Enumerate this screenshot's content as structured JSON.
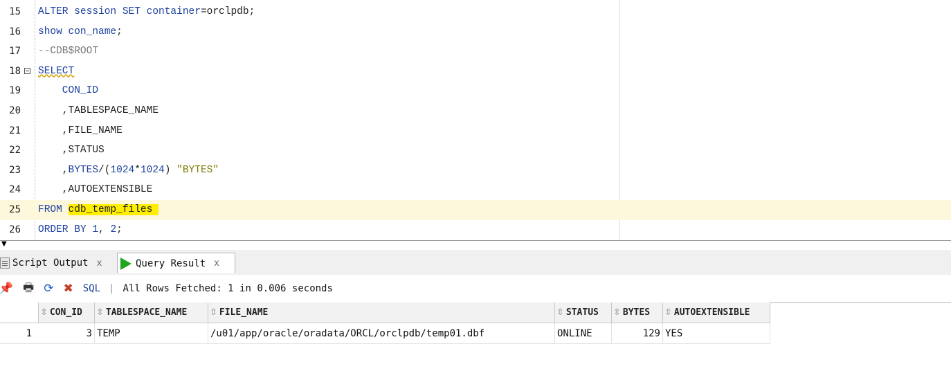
{
  "editor": {
    "lines": [
      {
        "num": "15",
        "text": "ALTER session SET container=orclpdb;"
      },
      {
        "num": "16",
        "text": "show con_name;"
      },
      {
        "num": "17",
        "text": "--CDB$ROOT"
      },
      {
        "num": "18",
        "text": "SELECT"
      },
      {
        "num": "19",
        "text": "    CON_ID"
      },
      {
        "num": "20",
        "text": "    ,TABLESPACE_NAME"
      },
      {
        "num": "21",
        "text": "    ,FILE_NAME"
      },
      {
        "num": "22",
        "text": "    ,STATUS"
      },
      {
        "num": "23",
        "text": "    ,BYTES/(1024*1024) \"BYTES\""
      },
      {
        "num": "24",
        "text": "    ,AUTOEXTENSIBLE"
      },
      {
        "num": "25",
        "text": "FROM cdb_temp_files"
      },
      {
        "num": "26",
        "text": "ORDER BY 1, 2;"
      }
    ]
  },
  "tabs": {
    "script_output": {
      "label": "Script Output",
      "close": "x"
    },
    "query_result": {
      "label": "Query Result",
      "close": "x"
    }
  },
  "toolbar": {
    "sql_label": "SQL",
    "separator": "|",
    "status": "All Rows Fetched: 1 in 0.006 seconds"
  },
  "grid": {
    "columns": [
      "CON_ID",
      "TABLESPACE_NAME",
      "FILE_NAME",
      "STATUS",
      "BYTES",
      "AUTOEXTENSIBLE"
    ],
    "rows": [
      {
        "row_num": "1",
        "cells": [
          "3",
          "TEMP",
          "/u01/app/oracle/oradata/ORCL/orclpdb/temp01.dbf",
          "ONLINE",
          "129",
          "YES"
        ]
      }
    ]
  }
}
